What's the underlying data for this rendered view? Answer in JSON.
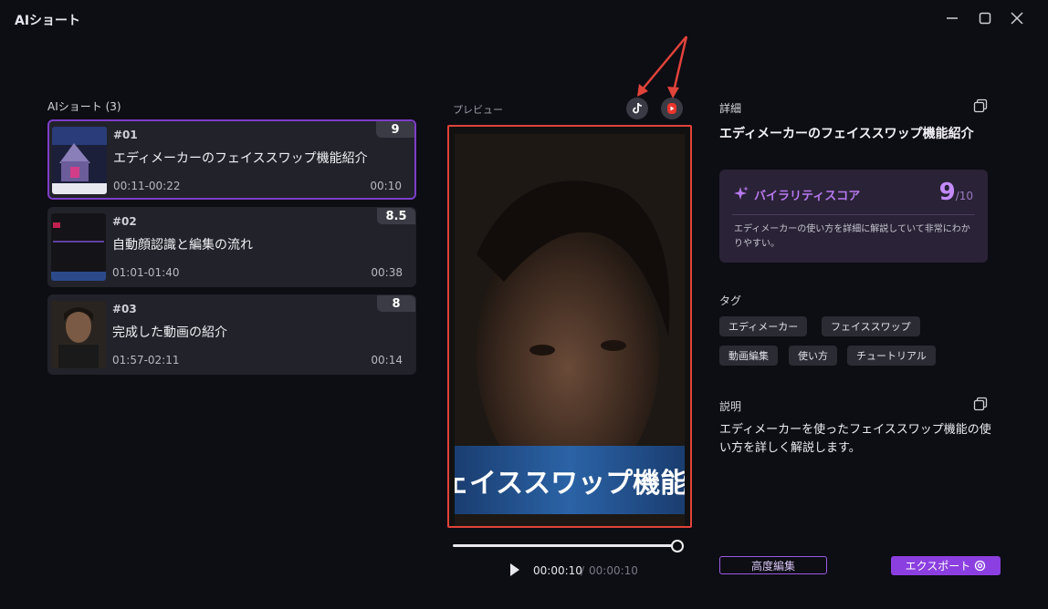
{
  "window": {
    "title": "AIショート"
  },
  "list": {
    "title": "AIショート (3)",
    "items": [
      {
        "num": "#01",
        "title": "エディメーカーのフェイススワップ機能紹介",
        "range": "00:11-00:22",
        "duration": "00:10",
        "score": "9"
      },
      {
        "num": "#02",
        "title": "自動顔認識と編集の流れ",
        "range": "01:01-01:40",
        "duration": "00:38",
        "score": "8.5"
      },
      {
        "num": "#03",
        "title": "完成した動画の紹介",
        "range": "01:57-02:11",
        "duration": "00:14",
        "score": "8"
      }
    ]
  },
  "preview": {
    "label": "プレビュー",
    "subtitle": "ェイススワップ機能の使い",
    "time_current": "00:00:10",
    "time_separator": "/",
    "time_total": "00:00:10",
    "progress": 1.0
  },
  "details": {
    "label": "詳細",
    "title": "エディメーカーのフェイススワップ機能紹介",
    "viral_label": "バイラリティスコア",
    "viral_score": "9",
    "viral_max": "/10",
    "viral_desc": "エディメーカーの使い方を詳細に解説していて非常にわかりやすい。",
    "tags_label": "タグ",
    "tags": [
      "エディメーカー",
      "フェイススワップ",
      "動画編集",
      "使い方",
      "チュートリアル"
    ],
    "desc_label": "説明",
    "desc": "エディメーカーを使ったフェイススワップ機能の使い方を詳しく解説します。"
  },
  "buttons": {
    "advanced": "高度編集",
    "export": "エクスポート"
  },
  "colors": {
    "accent": "#8b3fe0",
    "highlight": "#e0433a",
    "background": "#0d0d14"
  }
}
